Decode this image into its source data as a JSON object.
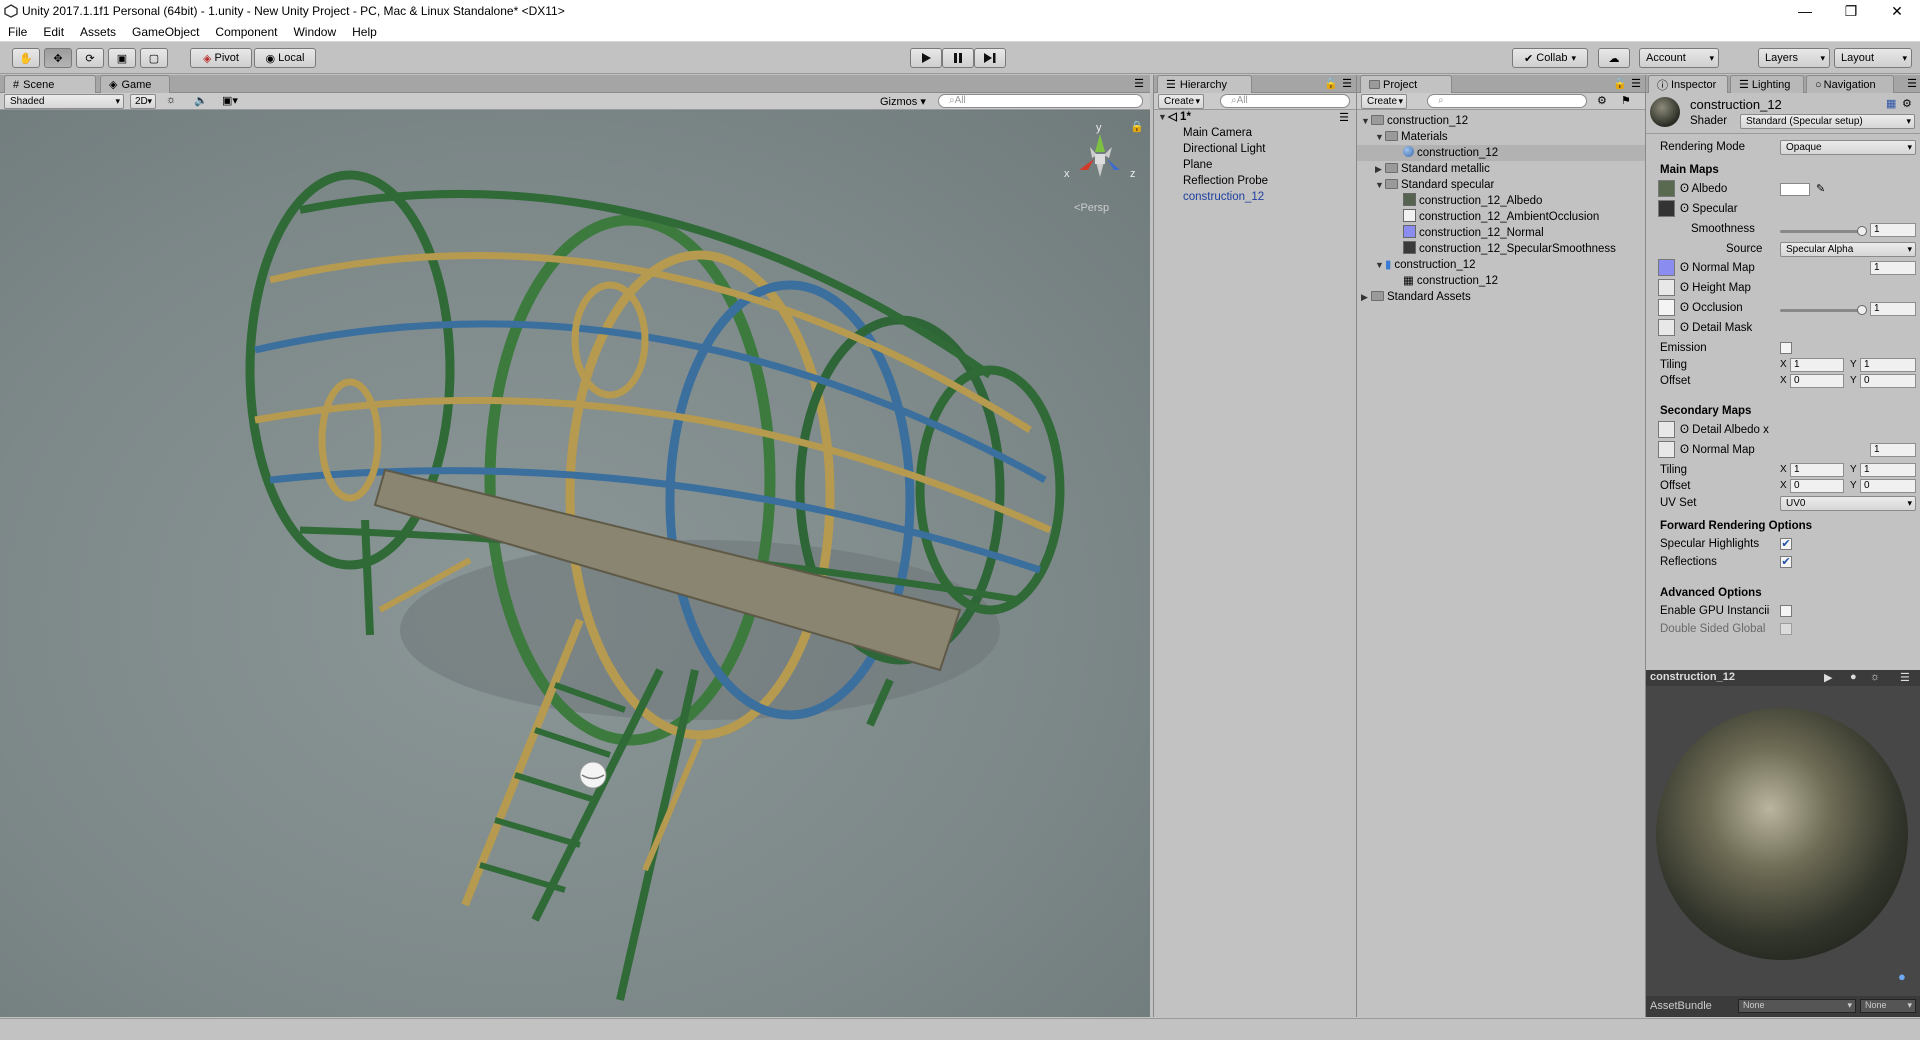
{
  "window": {
    "title": "Unity 2017.1.1f1 Personal (64bit) - 1.unity - New Unity Project - PC, Mac & Linux Standalone* <DX11>"
  },
  "menu": [
    "File",
    "Edit",
    "Assets",
    "GameObject",
    "Component",
    "Window",
    "Help"
  ],
  "toolbar": {
    "pivot": "Pivot",
    "local": "Local",
    "collab": "Collab",
    "account": "Account",
    "layers": "Layers",
    "layout": "Layout"
  },
  "scene": {
    "tab_scene": "Scene",
    "tab_game": "Game",
    "shading": "Shaded",
    "mode_2d": "2D",
    "gizmos": "Gizmos",
    "search_placeholder": "All",
    "persp": "Persp",
    "gizmo_x": "x",
    "gizmo_y": "y",
    "gizmo_z": "z"
  },
  "hierarchy": {
    "tab": "Hierarchy",
    "create": "Create",
    "search_placeholder": "All",
    "scene_name": "1*",
    "items": [
      "Main Camera",
      "Directional Light",
      "Plane",
      "Reflection Probe",
      "construction_12"
    ]
  },
  "project": {
    "tab": "Project",
    "create": "Create",
    "root": "construction_12",
    "materials": "Materials",
    "material_item": "construction_12",
    "standard_metallic": "Standard metallic",
    "standard_specular": "Standard specular",
    "textures": [
      "construction_12_Albedo",
      "construction_12_AmbientOcclusion",
      "construction_12_Normal",
      "construction_12_SpecularSmoothness"
    ],
    "prefab": "construction_12",
    "mesh": "construction_12",
    "standard_assets": "Standard Assets"
  },
  "inspector": {
    "tab": "Inspector",
    "tab_lighting": "Lighting",
    "tab_navigation": "Navigation",
    "object_name": "construction_12",
    "shader_label": "Shader",
    "shader_value": "Standard (Specular setup)",
    "rendering_mode_label": "Rendering Mode",
    "rendering_mode_value": "Opaque",
    "main_maps": "Main Maps",
    "albedo": "Albedo",
    "specular": "Specular",
    "smoothness": "Smoothness",
    "smoothness_value": "1",
    "source_label": "Source",
    "source_value": "Specular Alpha",
    "normal_map": "Normal Map",
    "normal_value": "1",
    "height_map": "Height Map",
    "occlusion": "Occlusion",
    "occlusion_value": "1",
    "detail_mask": "Detail Mask",
    "emission": "Emission",
    "tiling": "Tiling",
    "offset": "Offset",
    "tiling_x": "1",
    "tiling_y": "1",
    "offset_x": "0",
    "offset_y": "0",
    "secondary_maps": "Secondary Maps",
    "detail_albedo": "Detail Albedo x",
    "sec_normal_map": "Normal Map",
    "sec_normal_value": "1",
    "sec_tiling_x": "1",
    "sec_tiling_y": "1",
    "sec_offset_x": "0",
    "sec_offset_y": "0",
    "uv_set_label": "UV Set",
    "uv_set_value": "UV0",
    "forward": "Forward Rendering Options",
    "spec_highlights": "Specular Highlights",
    "reflections": "Reflections",
    "advanced": "Advanced Options",
    "gpu_instancing": "Enable GPU Instancii",
    "double_sided": "Double Sided Global",
    "axis_x": "X",
    "axis_y": "Y",
    "smoothness_level": 1.0,
    "occlusion_level": 1.0
  },
  "preview": {
    "title": "construction_12",
    "assetbundle": "AssetBundle",
    "ab_name": "None",
    "ab_variant": "None"
  },
  "colors": {
    "accent_blue": "#2b53a8",
    "selected_row": "#b6b6b6",
    "scene_bg": "#7f8b8c"
  }
}
